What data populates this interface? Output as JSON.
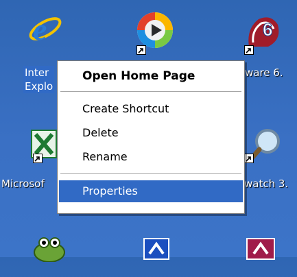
{
  "desktop": {
    "icons": [
      {
        "name": "internet-explorer",
        "label": "Inter\nExplo"
      },
      {
        "name": "windows-media-player",
        "label": ""
      },
      {
        "name": "app-6",
        "label": "ware 6."
      },
      {
        "name": "microsoft-excel",
        "label": "Microsof"
      },
      {
        "name": "search-tool",
        "label": "watch 3."
      }
    ]
  },
  "context_menu": {
    "items": [
      {
        "label": "Open Home Page",
        "bold": true
      },
      {
        "label": "Create Shortcut"
      },
      {
        "label": "Delete"
      },
      {
        "label": "Rename"
      },
      {
        "label": "Properties",
        "highlighted": true
      }
    ]
  },
  "colors": {
    "desktop": "#3a70c4",
    "highlight": "#316ac5",
    "menu_bg": "#ffffff"
  }
}
